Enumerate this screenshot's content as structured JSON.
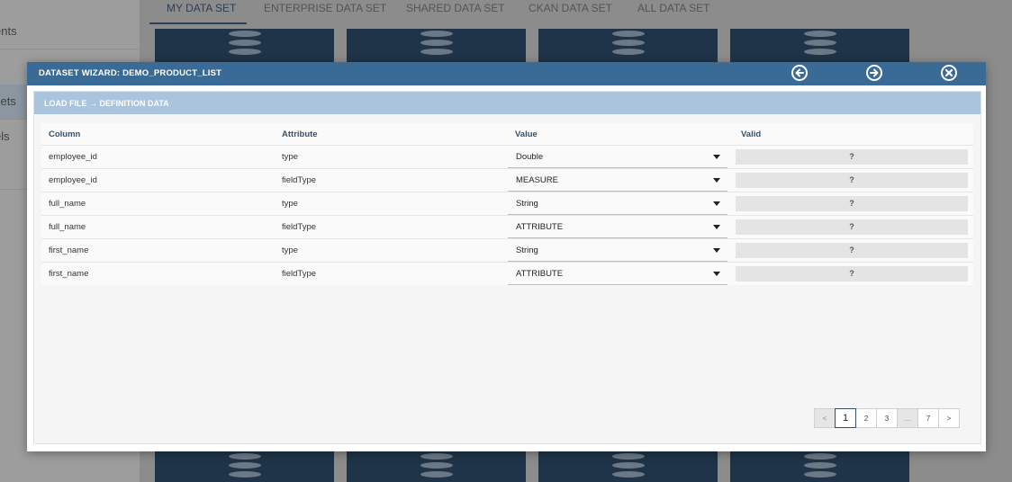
{
  "background": {
    "sidebar_items": [
      {
        "label": "ents",
        "active": false
      },
      {
        "label": "sets",
        "active": true
      },
      {
        "label": "els",
        "active": false
      },
      {
        "label": "s",
        "active": false
      }
    ],
    "tabs": [
      {
        "label": "MY DATA SET",
        "active": true
      },
      {
        "label": "ENTERPRISE DATA SET",
        "active": false
      },
      {
        "label": "SHARED DATA SET",
        "active": false
      },
      {
        "label": "CKAN DATA SET",
        "active": false
      },
      {
        "label": "ALL DATA SET",
        "active": false
      }
    ]
  },
  "modal": {
    "title": "DATASET WIZARD: DEMO_PRODUCT_LIST",
    "buttons": {
      "back_icon": "arrow-left-circle-icon",
      "next_icon": "arrow-right-circle-icon",
      "close_icon": "close-circle-icon"
    },
    "section_title": "LOAD FILE → DEFINITION DATA",
    "table": {
      "headers": {
        "column": "Column",
        "attribute": "Attribute",
        "value": "Value",
        "valid": "Valid"
      },
      "rows": [
        {
          "column": "employee_id",
          "attribute": "type",
          "value": "Double",
          "valid": "?"
        },
        {
          "column": "employee_id",
          "attribute": "fieldType",
          "value": "MEASURE",
          "valid": "?"
        },
        {
          "column": "full_name",
          "attribute": "type",
          "value": "String",
          "valid": "?"
        },
        {
          "column": "full_name",
          "attribute": "fieldType",
          "value": "ATTRIBUTE",
          "valid": "?"
        },
        {
          "column": "first_name",
          "attribute": "type",
          "value": "String",
          "valid": "?"
        },
        {
          "column": "first_name",
          "attribute": "fieldType",
          "value": "ATTRIBUTE",
          "valid": "?"
        }
      ]
    },
    "pagination": {
      "prev": "<",
      "pages": [
        "1",
        "2",
        "3",
        "...",
        "7"
      ],
      "next": ">",
      "current": "1"
    }
  },
  "colors": {
    "header": "#3a6a96",
    "section_bar": "#a9c4dc",
    "dark_card": "#1f3449"
  }
}
